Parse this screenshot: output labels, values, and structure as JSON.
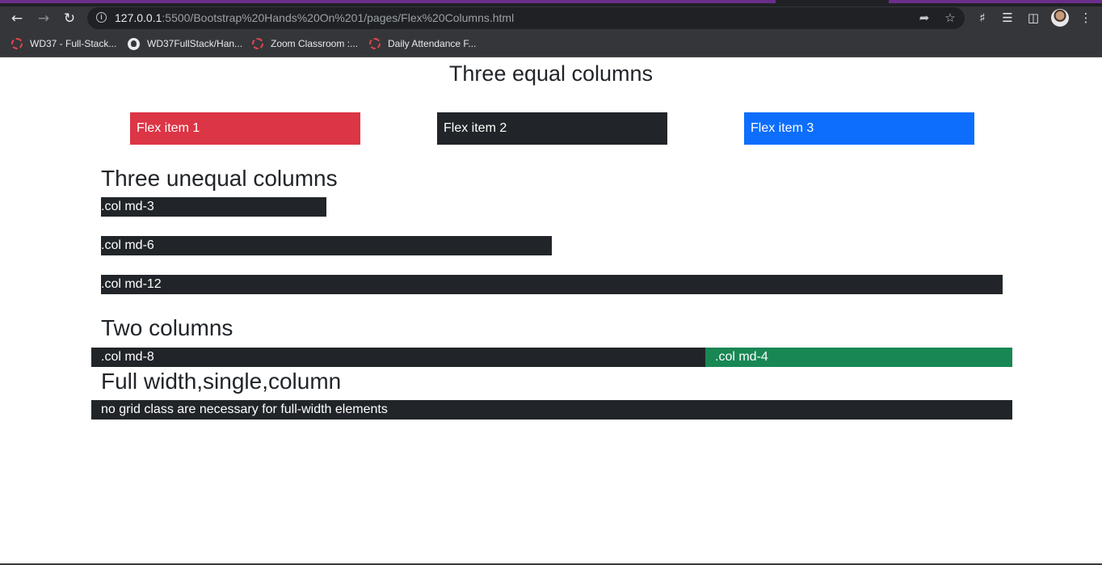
{
  "browser": {
    "url_host": "127.0.0.1",
    "url_rest": ":5500/Bootstrap%20Hands%20On%201/pages/Flex%20Columns.html",
    "bookmarks": [
      {
        "label": "WD37 - Full-Stack...",
        "icon": "zoom-dashed-icon"
      },
      {
        "label": "WD37FullStack/Han...",
        "icon": "github-icon"
      },
      {
        "label": "Zoom Classroom :...",
        "icon": "zoom-dashed-icon"
      },
      {
        "label": "Daily Attendance F...",
        "icon": "zoom-dashed-icon"
      }
    ]
  },
  "colors": {
    "danger": "#dc3545",
    "dark": "#212529",
    "primary": "#0d6efd",
    "success": "#198754"
  },
  "equal": {
    "title": "Three equal columns",
    "items": [
      "Flex item 1",
      "Flex item 2",
      "Flex item 3"
    ]
  },
  "unequal": {
    "title": "Three unequal columns",
    "items": [
      ".col md-3",
      ".col md-6",
      ".col md-12"
    ]
  },
  "two": {
    "title": "Two columns",
    "items": [
      ".col md-8",
      ".col md-4"
    ]
  },
  "full": {
    "title": "Full width,single,column",
    "text": "no grid class are necessary for full-width elements"
  }
}
